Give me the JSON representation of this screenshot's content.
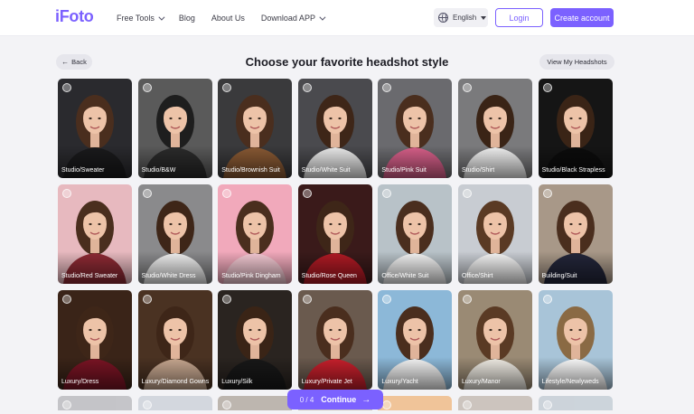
{
  "header": {
    "logo": "iFoto",
    "nav": [
      {
        "label": "Free Tools",
        "dropdown": true
      },
      {
        "label": "Blog",
        "dropdown": false
      },
      {
        "label": "About Us",
        "dropdown": false
      },
      {
        "label": "Download APP",
        "dropdown": true
      }
    ],
    "language": "English",
    "login_label": "Login",
    "create_label": "Create account"
  },
  "subheader": {
    "back_label": "Back",
    "title": "Choose your favorite headshot style",
    "view_label": "View My Headshots"
  },
  "styles": [
    {
      "label": "Studio/Sweater",
      "bg": "#2a2a2e",
      "outfit": "#1a1a1c",
      "hair": "#4a2e1e"
    },
    {
      "label": "Studio/B&W",
      "bg": "#5a5a5a",
      "outfit": "#2b2b2b",
      "hair": "#1e1e1e"
    },
    {
      "label": "Studio/Brownish Suit",
      "bg": "#3a3a3c",
      "outfit": "#8a5a34",
      "hair": "#4a2e1e"
    },
    {
      "label": "Studio/White Suit",
      "bg": "#4a4a4e",
      "outfit": "#ececec",
      "hair": "#3e2618"
    },
    {
      "label": "Studio/Pink Suit",
      "bg": "#6a6a6e",
      "outfit": "#d8608a",
      "hair": "#4a2e1e"
    },
    {
      "label": "Studio/Shirt",
      "bg": "#7a7a7c",
      "outfit": "#f2f2f2",
      "hair": "#3a2416"
    },
    {
      "label": "Studio/Black Strapless",
      "bg": "#151515",
      "outfit": "#0c0c0c",
      "hair": "#3a2416"
    },
    {
      "label": "Studio/Red Sweater",
      "bg": "#e7b9bf",
      "outfit": "#8e2a34",
      "hair": "#4a2e1e"
    },
    {
      "label": "Studio/White Dress",
      "bg": "#8a8a8c",
      "outfit": "#f0f0f0",
      "hair": "#3e2618"
    },
    {
      "label": "Studio/Pink Dingham",
      "bg": "#f1a9bb",
      "outfit": "#f4c9d3",
      "hair": "#4a2e1e"
    },
    {
      "label": "Studio/Rose Queen",
      "bg": "#3a1a1a",
      "outfit": "#b01a24",
      "hair": "#3e2618"
    },
    {
      "label": "Office/White Suit",
      "bg": "#b8c2c8",
      "outfit": "#f4f4f4",
      "hair": "#4a2e1e"
    },
    {
      "label": "Office/Shirt",
      "bg": "#c8ccd2",
      "outfit": "#f6f6f6",
      "hair": "#5a3a24"
    },
    {
      "label": "Building/Suit",
      "bg": "#a89888",
      "outfit": "#23263a",
      "hair": "#4a2e1e"
    },
    {
      "label": "Luxury/Dress",
      "bg": "#3a2418",
      "outfit": "#7a1424",
      "hair": "#3e2618"
    },
    {
      "label": "Luxury/Diamond Gowns",
      "bg": "#4a3222",
      "outfit": "#c8a890",
      "hair": "#3e2618"
    },
    {
      "label": "Luxury/Silk",
      "bg": "#2a2420",
      "outfit": "#181818",
      "hair": "#3a2416"
    },
    {
      "label": "Luxury/Private Jet",
      "bg": "#6a5a4e",
      "outfit": "#c8202c",
      "hair": "#4a2e1e"
    },
    {
      "label": "Luxury/Yacht",
      "bg": "#8cb8d8",
      "outfit": "#f4f4f4",
      "hair": "#4a2e1e"
    },
    {
      "label": "Luxury/Manor",
      "bg": "#9a8a74",
      "outfit": "#f0ece4",
      "hair": "#5a3a24"
    },
    {
      "label": "Lifestyle/Newlyweds",
      "bg": "#a8c4d8",
      "outfit": "#fbfbfb",
      "hair": "#8a6a44"
    }
  ],
  "partial_row": [
    "#c0c0c4",
    "#d0d4dc",
    "#b8b0a8",
    "#c4b8b0",
    "#f0c090",
    "#c8c0b8",
    "#c8d0d8"
  ],
  "continue": {
    "count": "0 / 4",
    "label": "Continue"
  }
}
